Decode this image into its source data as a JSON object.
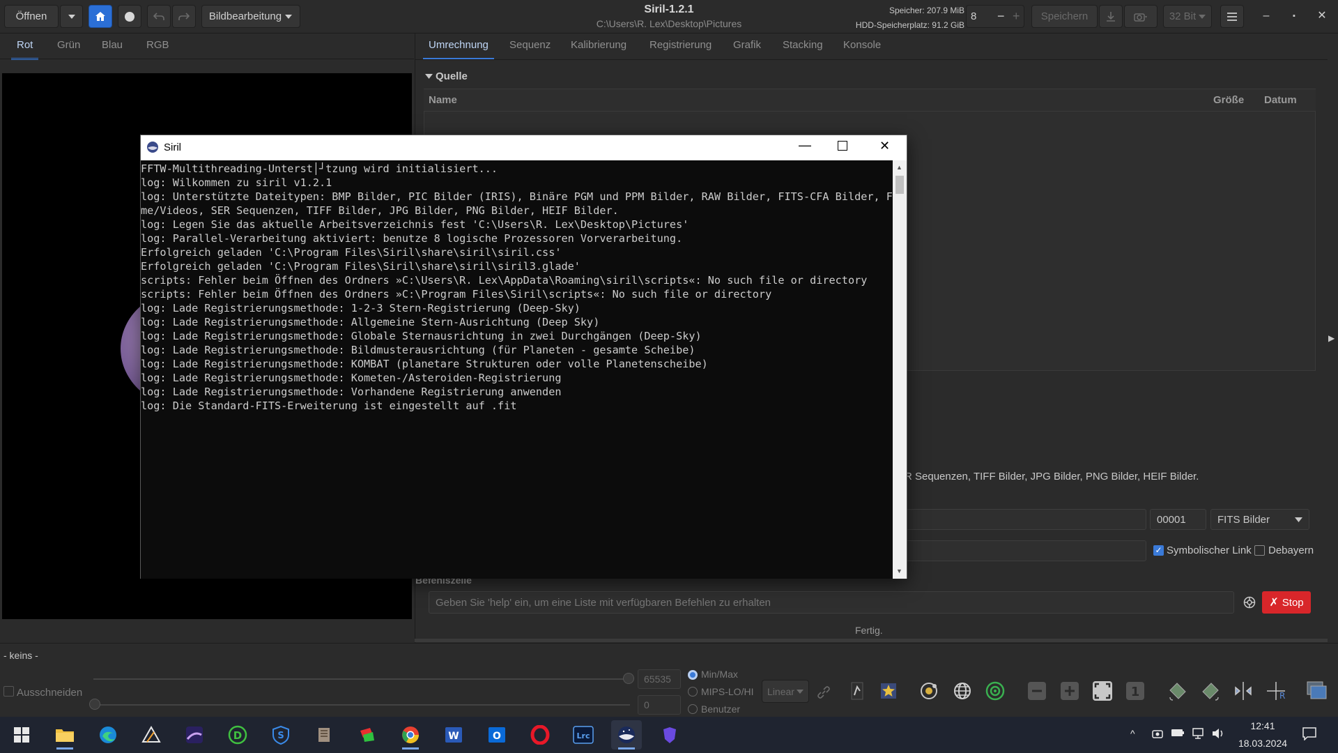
{
  "header": {
    "open_label": "Öffnen",
    "image_edit_label": "Bildbearbeitung",
    "title": "Siril-1.2.1",
    "path": "C:\\Users\\R. Lex\\Desktop\\Pictures",
    "memory": "Speicher: 207.9 MiB",
    "disk": "HDD-Speicherplatz: 91.2 GiB",
    "threads_value": "8",
    "save_label": "Speichern",
    "bit_depth": "32 Bit"
  },
  "left_tabs": [
    "Rot",
    "Grün",
    "Blau",
    "RGB"
  ],
  "right_tabs": [
    "Umrechnung",
    "Sequenz",
    "Kalibrierung",
    "Registrierung",
    "Grafik",
    "Stacking",
    "Konsole"
  ],
  "conversion": {
    "source_label": "Quelle",
    "col_name": "Name",
    "col_size": "Größe",
    "col_date": "Datum",
    "supported_text": "R Sequenzen, TIFF Bilder, JPG Bilder, PNG Bilder, HEIF Bilder.",
    "index_value": "00001",
    "format_value": "FITS Bilder",
    "symlink_label": "Symbolischer Link",
    "debayer_label": "Debayern"
  },
  "command": {
    "section_label": "Befehlszeile",
    "placeholder": "Geben Sie 'help' ein, um eine Liste mit verfügbaren Befehlen zu erhalten",
    "stop_label": "Stop",
    "status": "Fertig."
  },
  "bottom": {
    "filename": "- keins -",
    "crop_label": "Ausschneiden",
    "max_value": "65535",
    "min_value": "0",
    "mode_minmax": "Min/Max",
    "mode_mips": "MIPS-LO/HI",
    "mode_user": "Benutzer",
    "scale_value": "Linear"
  },
  "console": {
    "title": "Siril",
    "lines": [
      "FFTW-Multithreading-Unterst│┘tzung wird initialisiert...",
      "log: Wilkommen zu siril v1.2.1",
      "log: Unterstützte Dateitypen: BMP Bilder, PIC Bilder (IRIS), Binäre PGM und PPM Bilder, RAW Bilder, FITS-CFA Bilder, Fil",
      "me/Videos, SER Sequenzen, TIFF Bilder, JPG Bilder, PNG Bilder, HEIF Bilder.",
      "log: Legen Sie das aktuelle Arbeitsverzeichnis fest 'C:\\Users\\R. Lex\\Desktop\\Pictures'",
      "log: Parallel-Verarbeitung aktiviert: benutze 8 logische Prozessoren Vorverarbeitung.",
      "Erfolgreich geladen 'C:\\Program Files\\Siril\\share\\siril\\siril.css'",
      "Erfolgreich geladen 'C:\\Program Files\\Siril\\share\\siril\\siril3.glade'",
      "scripts: Fehler beim Öffnen des Ordners »C:\\Users\\R. Lex\\AppData\\Roaming\\siril\\scripts«: No such file or directory",
      "scripts: Fehler beim Öffnen des Ordners »C:\\Program Files\\Siril\\scripts«: No such file or directory",
      "log: Lade Registrierungsmethode: 1-2-3 Stern-Registrierung (Deep-Sky)",
      "log: Lade Registrierungsmethode: Allgemeine Stern-Ausrichtung (Deep Sky)",
      "log: Lade Registrierungsmethode: Globale Sternausrichtung in zwei Durchgängen (Deep-Sky)",
      "log: Lade Registrierungsmethode: Bildmusterausrichtung (für Planeten - gesamte Scheibe)",
      "log: Lade Registrierungsmethode: KOMBAT (planetare Strukturen oder volle Planetenscheibe)",
      "log: Lade Registrierungsmethode: Kometen-/Asteroiden-Registrierung",
      "log: Lade Registrierungsmethode: Vorhandene Registrierung anwenden",
      "log: Die Standard-FITS-Erweiterung ist eingestellt auf .fit"
    ]
  },
  "taskbar": {
    "time": "12:41",
    "date": "18.03.2024",
    "apps": [
      "start-icon",
      "file-explorer-icon",
      "edge-icon",
      "affinity-icon",
      "astro-icon",
      "d-app-icon",
      "s-app-icon",
      "tool-icon",
      "photo-app-icon",
      "chrome-icon",
      "word-icon",
      "outlook-icon",
      "opera-icon",
      "lightroom-icon",
      "siril-icon",
      "proton-icon"
    ]
  }
}
